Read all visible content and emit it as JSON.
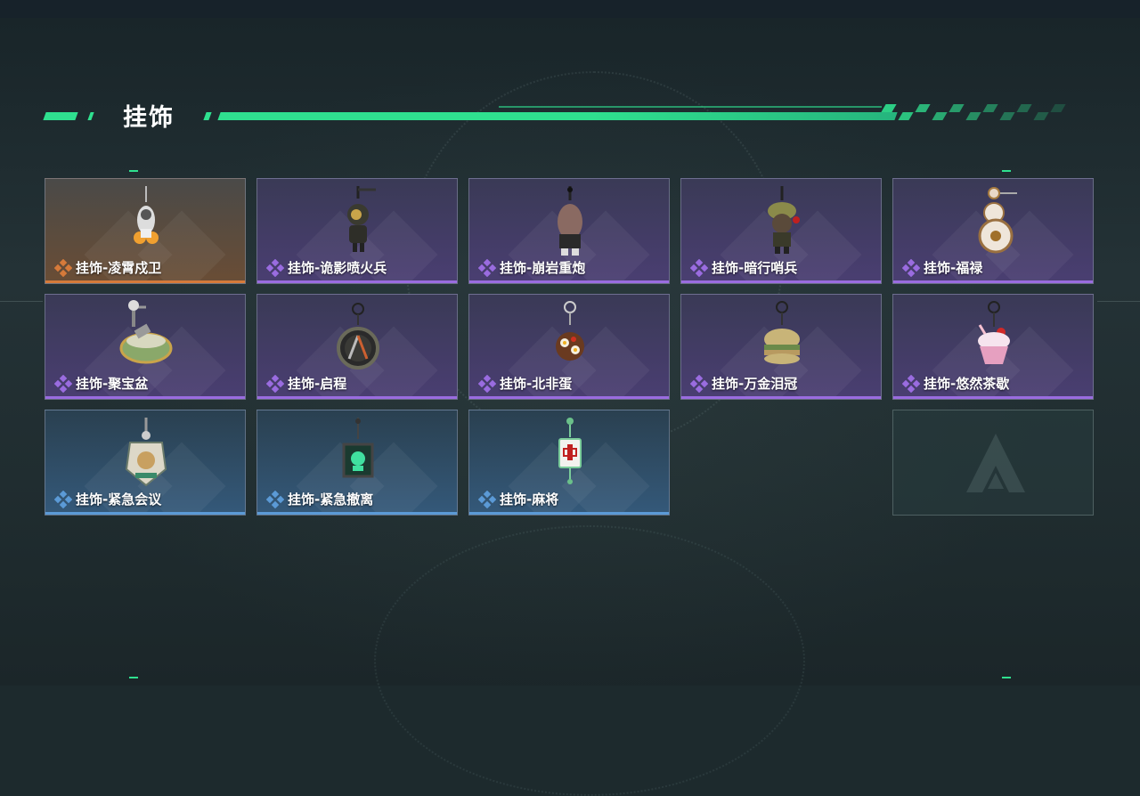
{
  "section": {
    "title": "挂饰"
  },
  "colors": {
    "accent": "#2fe08f",
    "rarity_orange": "#d67a3a",
    "rarity_purple": "#9a6ce0",
    "rarity_blue": "#5b9ad6"
  },
  "items": [
    {
      "label": "挂饰-凌霄戍卫",
      "rarity": "orange",
      "icon": "rocket-soldier-charm-icon"
    },
    {
      "label": "挂饰-诡影喷火兵",
      "rarity": "purple",
      "icon": "flamethrower-soldier-charm-icon"
    },
    {
      "label": "挂饰-崩岩重炮",
      "rarity": "purple",
      "icon": "heavy-gunner-charm-icon"
    },
    {
      "label": "挂饰-暗行哨兵",
      "rarity": "purple",
      "icon": "sentinel-charm-icon"
    },
    {
      "label": "挂饰-福禄",
      "rarity": "purple",
      "icon": "gourd-charm-icon"
    },
    {
      "label": "挂饰-聚宝盆",
      "rarity": "purple",
      "icon": "treasure-bowl-charm-icon"
    },
    {
      "label": "挂饰-启程",
      "rarity": "purple",
      "icon": "compass-ring-charm-icon"
    },
    {
      "label": "挂饰-北非蛋",
      "rarity": "purple",
      "icon": "shakshuka-pan-charm-icon"
    },
    {
      "label": "挂饰-万金泪冠",
      "rarity": "purple",
      "icon": "gold-burger-charm-icon"
    },
    {
      "label": "挂饰-悠然茶歇",
      "rarity": "purple",
      "icon": "cupcake-charm-icon"
    },
    {
      "label": "挂饰-紧急会议",
      "rarity": "blue",
      "icon": "meeting-badge-charm-icon"
    },
    {
      "label": "挂饰-紧急撤离",
      "rarity": "blue",
      "icon": "evacuation-cube-charm-icon"
    },
    {
      "label": "挂饰-麻将",
      "rarity": "blue",
      "icon": "mahjong-tile-charm-icon"
    }
  ],
  "empty_slot": {
    "icon": "game-logo-icon"
  }
}
